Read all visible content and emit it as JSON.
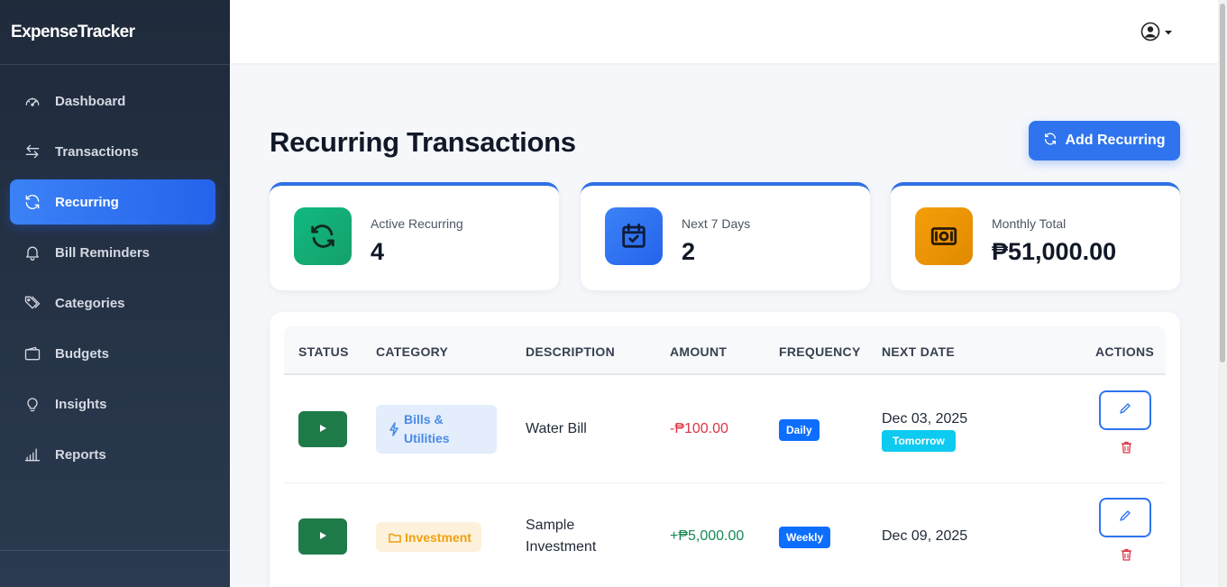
{
  "app": {
    "brand": "ExpenseTracker"
  },
  "sidebar": {
    "items": [
      {
        "label": "Dashboard",
        "icon": "gauge-icon",
        "active": false
      },
      {
        "label": "Transactions",
        "icon": "arrows-exchange-icon",
        "active": false
      },
      {
        "label": "Recurring",
        "icon": "refresh-icon",
        "active": true
      },
      {
        "label": "Bill Reminders",
        "icon": "bell-icon",
        "active": false
      },
      {
        "label": "Categories",
        "icon": "tags-icon",
        "active": false
      },
      {
        "label": "Budgets",
        "icon": "wallet-icon",
        "active": false
      },
      {
        "label": "Insights",
        "icon": "lightbulb-icon",
        "active": false
      },
      {
        "label": "Reports",
        "icon": "bar-chart-icon",
        "active": false
      }
    ]
  },
  "header": {
    "user_icon": "user-circle-icon"
  },
  "page": {
    "title": "Recurring Transactions",
    "add_button": "Add Recurring"
  },
  "stats": [
    {
      "label": "Active Recurring",
      "value": "4",
      "icon": "refresh-icon",
      "color": "#10b981"
    },
    {
      "label": "Next 7 Days",
      "value": "2",
      "icon": "calendar-check-icon",
      "color": "#2f6fe4"
    },
    {
      "label": "Monthly Total",
      "value": "₱51,000.00",
      "icon": "cash-icon",
      "color": "#f59e0b"
    }
  ],
  "table": {
    "headers": [
      "STATUS",
      "CATEGORY",
      "DESCRIPTION",
      "AMOUNT",
      "FREQUENCY",
      "NEXT DATE",
      "ACTIONS"
    ],
    "rows": [
      {
        "category": "Bills & Utilities",
        "category_line1": "Bills &",
        "category_line2": "Utilities",
        "category_icon": "lightning-icon",
        "description": "Water Bill",
        "amount": "-₱100.00",
        "amount_color": "#dc3545",
        "frequency": "Daily",
        "next_date": "Dec 03, 2025",
        "badge": "Tomorrow"
      },
      {
        "category": "Investment",
        "category_icon": "folder-icon",
        "description_line1": "Sample",
        "description_line2": "Investment",
        "amount": "+₱5,000.00",
        "amount_color": "#198754",
        "frequency": "Weekly",
        "next_date": "Dec 09, 2025"
      }
    ]
  },
  "colors": {
    "accent": "#2f74ee",
    "sidebar_bg": "#1f2a3b",
    "status_active": "#1f7a4a",
    "badge_info": "#0dcaf0",
    "badge_primary": "#0d6efd"
  }
}
